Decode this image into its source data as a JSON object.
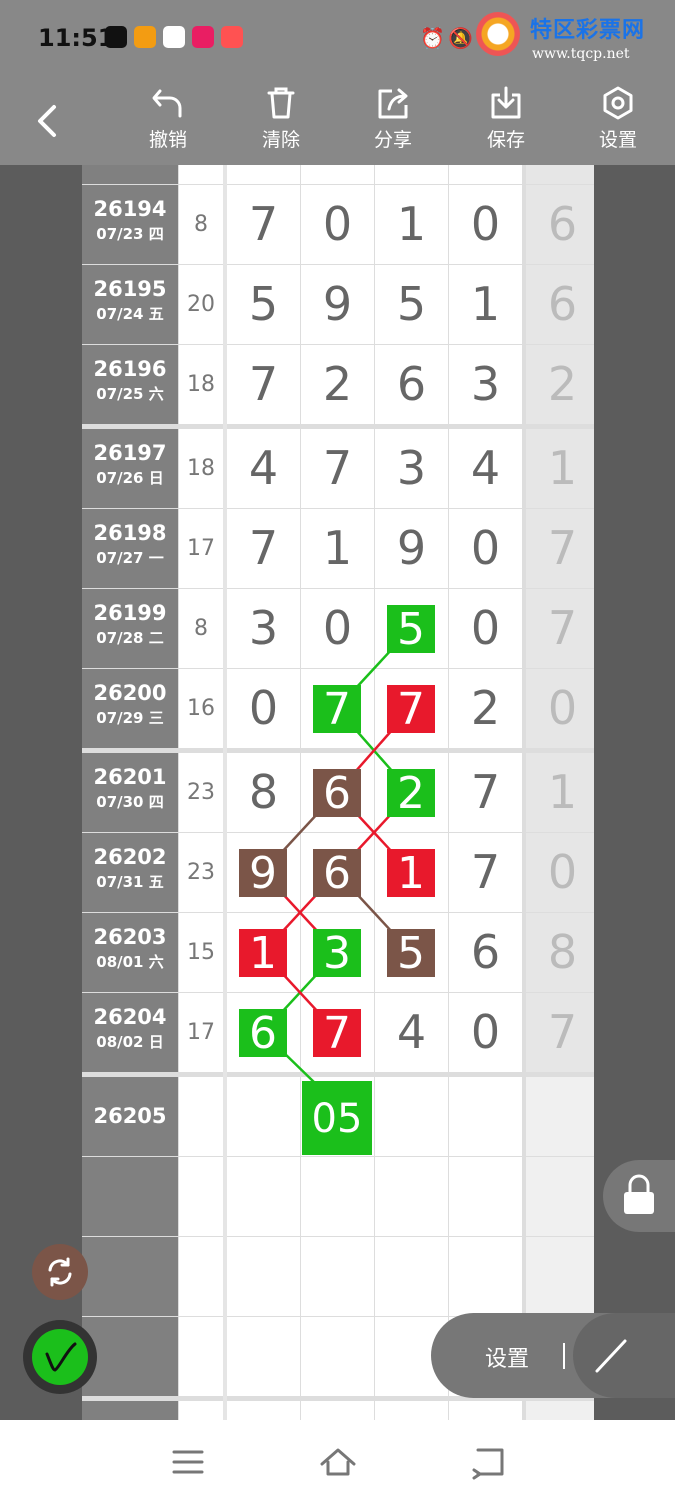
{
  "status": {
    "time": "11:51"
  },
  "watermark": {
    "title": "特区彩票网",
    "url": "www.tqcp.net"
  },
  "toolbar": {
    "undo": "撤销",
    "clear": "清除",
    "share": "分享",
    "save": "保存",
    "settings": "设置"
  },
  "rows": [
    {
      "period": "26194",
      "date": "07/23 四",
      "sum": "8",
      "digits": [
        "7",
        "0",
        "1",
        "0"
      ],
      "extra": "6"
    },
    {
      "period": "26195",
      "date": "07/24 五",
      "sum": "20",
      "digits": [
        "5",
        "9",
        "5",
        "1"
      ],
      "extra": "6"
    },
    {
      "period": "26196",
      "date": "07/25 六",
      "sum": "18",
      "digits": [
        "7",
        "2",
        "6",
        "3"
      ],
      "extra": "2"
    },
    {
      "period": "26197",
      "date": "07/26 日",
      "sum": "18",
      "digits": [
        "4",
        "7",
        "3",
        "4"
      ],
      "extra": "1"
    },
    {
      "period": "26198",
      "date": "07/27 一",
      "sum": "17",
      "digits": [
        "7",
        "1",
        "9",
        "0"
      ],
      "extra": "7"
    },
    {
      "period": "26199",
      "date": "07/28 二",
      "sum": "8",
      "digits": [
        "3",
        "0",
        "5",
        "0"
      ],
      "extra": "7"
    },
    {
      "period": "26200",
      "date": "07/29 三",
      "sum": "16",
      "digits": [
        "0",
        "7",
        "7",
        "2"
      ],
      "extra": "0"
    },
    {
      "period": "26201",
      "date": "07/30 四",
      "sum": "23",
      "digits": [
        "8",
        "6",
        "2",
        "7"
      ],
      "extra": "1"
    },
    {
      "period": "26202",
      "date": "07/31 五",
      "sum": "23",
      "digits": [
        "9",
        "6",
        "1",
        "7"
      ],
      "extra": "0"
    },
    {
      "period": "26203",
      "date": "08/01 六",
      "sum": "15",
      "digits": [
        "1",
        "3",
        "5",
        "6"
      ],
      "extra": "8"
    },
    {
      "period": "26204",
      "date": "08/02 日",
      "sum": "17",
      "digits": [
        "6",
        "7",
        "4",
        "0"
      ],
      "extra": "7"
    }
  ],
  "highlights": [
    {
      "row": 5,
      "col": 2,
      "color": "green"
    },
    {
      "row": 6,
      "col": 1,
      "color": "green"
    },
    {
      "row": 6,
      "col": 2,
      "color": "red"
    },
    {
      "row": 7,
      "col": 1,
      "color": "brown"
    },
    {
      "row": 7,
      "col": 2,
      "color": "green"
    },
    {
      "row": 8,
      "col": 0,
      "color": "brown"
    },
    {
      "row": 8,
      "col": 1,
      "color": "brown"
    },
    {
      "row": 8,
      "col": 2,
      "color": "red"
    },
    {
      "row": 9,
      "col": 0,
      "color": "red"
    },
    {
      "row": 9,
      "col": 1,
      "color": "green"
    },
    {
      "row": 9,
      "col": 2,
      "color": "brown"
    },
    {
      "row": 10,
      "col": 0,
      "color": "green"
    },
    {
      "row": 10,
      "col": 1,
      "color": "red"
    }
  ],
  "next": {
    "period": "26205",
    "prediction": "05"
  },
  "pill": {
    "label": "设置"
  },
  "colors": {
    "green": "#1bbf1b",
    "red": "#e8192c",
    "brown": "#7b5548"
  }
}
